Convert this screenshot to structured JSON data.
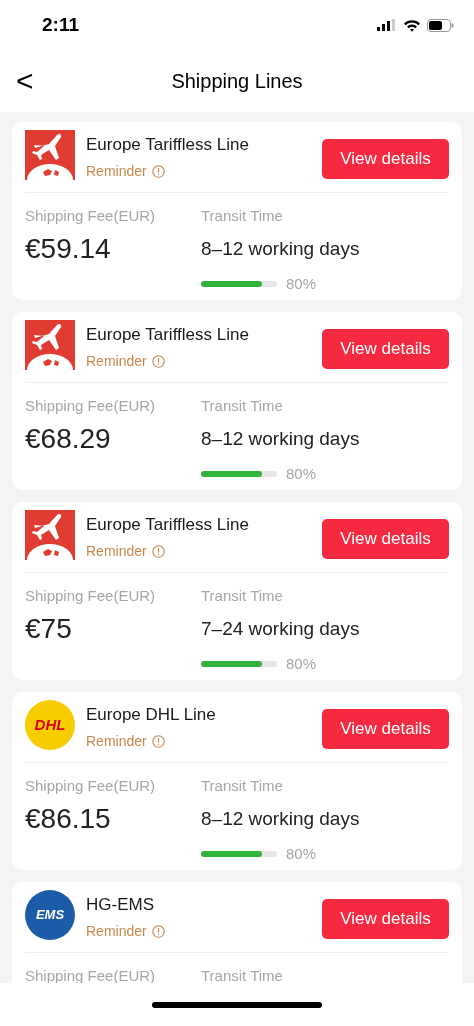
{
  "status_bar": {
    "time": "2:11"
  },
  "header": {
    "back": "<",
    "title": "Shipping Lines"
  },
  "lines": [
    {
      "logo": {
        "kind": "plane"
      },
      "name": "Europe Tariffless Line",
      "reminder": "Reminder",
      "button": "View details",
      "fee_label": "Shipping Fee(EUR)",
      "fee": "€59.14",
      "transit_label": "Transit Time",
      "transit": "8–12 working days",
      "level": 0.8,
      "percent": "80%"
    },
    {
      "logo": {
        "kind": "plane"
      },
      "name": "Europe Tariffless Line",
      "reminder": "Reminder",
      "button": "View details",
      "fee_label": "Shipping Fee(EUR)",
      "fee": "€68.29",
      "transit_label": "Transit Time",
      "transit": "8–12 working days",
      "level": 0.8,
      "percent": "80%"
    },
    {
      "logo": {
        "kind": "plane"
      },
      "name": "Europe Tariffless Line",
      "reminder": "Reminder",
      "button": "View details",
      "fee_label": "Shipping Fee(EUR)",
      "fee": "€75",
      "transit_label": "Transit Time",
      "transit": "7–24 working days",
      "level": 0.8,
      "percent": "80%"
    },
    {
      "logo": {
        "kind": "dhl",
        "text": "DHL"
      },
      "name": "Europe DHL Line",
      "reminder": "Reminder",
      "button": "View details",
      "fee_label": "Shipping Fee(EUR)",
      "fee": "€86.15",
      "transit_label": "Transit Time",
      "transit": "8–12 working days",
      "level": 0.8,
      "percent": "80%"
    },
    {
      "logo": {
        "kind": "ems",
        "text": "EMS"
      },
      "name": "HG-EMS",
      "reminder": "Reminder",
      "button": "View details",
      "fee_label": "Shipping Fee(EUR)",
      "transit_label": "Transit Time"
    }
  ]
}
